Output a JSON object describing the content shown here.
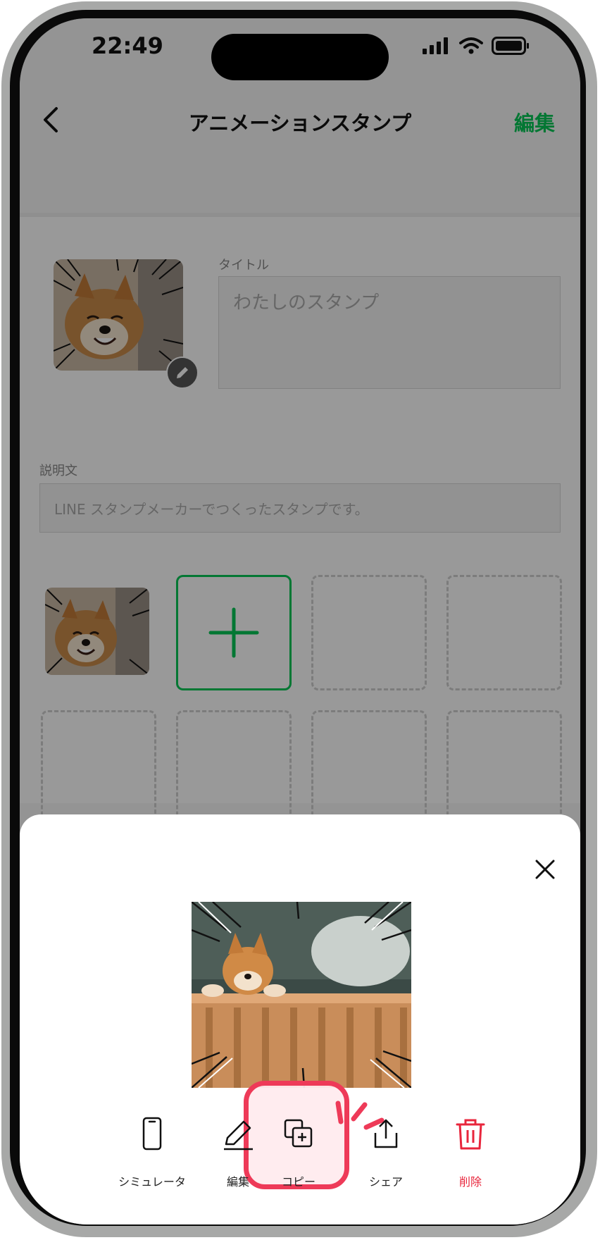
{
  "status_bar": {
    "time": "22:49"
  },
  "navbar": {
    "title": "アニメーションスタンプ",
    "edit": "編集"
  },
  "form": {
    "title_label": "タイトル",
    "title_placeholder": "わたしのスタンプ",
    "description_label": "説明文",
    "description_placeholder": "LINE スタンプメーカーでつくったスタンプです。"
  },
  "sheet": {
    "actions": [
      {
        "label": "シミュレータ",
        "icon": "phone-icon"
      },
      {
        "label": "編集",
        "icon": "pencil-icon"
      },
      {
        "label": "コピー",
        "icon": "copy-icon"
      },
      {
        "label": "シェア",
        "icon": "share-icon"
      },
      {
        "label": "削除",
        "icon": "trash-icon"
      }
    ]
  },
  "colors": {
    "accent": "#06c755",
    "danger": "#e8263c",
    "highlight": "#ee3a58"
  }
}
